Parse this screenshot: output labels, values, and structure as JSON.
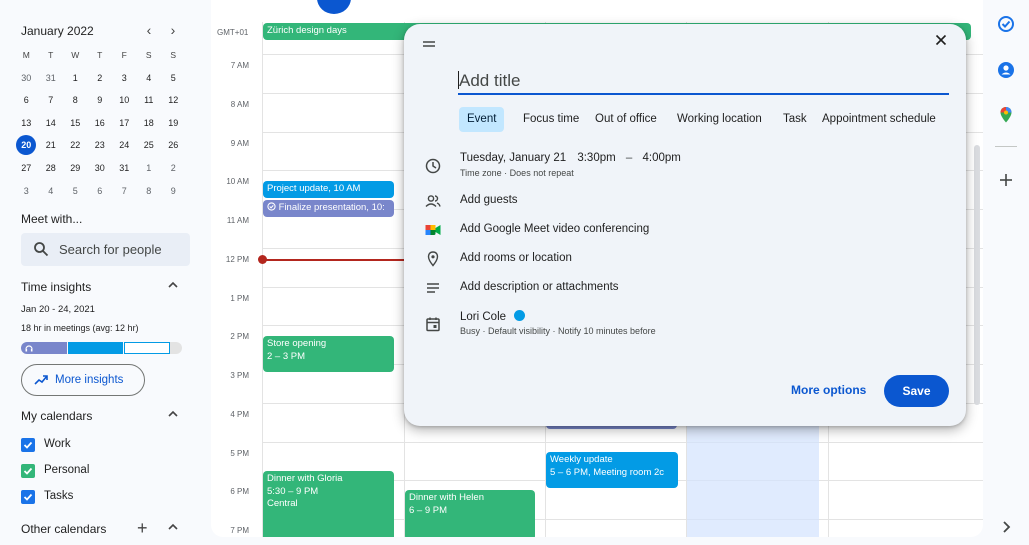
{
  "mini_calendar": {
    "month_label": "January 2022",
    "prev": "‹",
    "next": "›",
    "weekdays": [
      "M",
      "T",
      "W",
      "T",
      "F",
      "S",
      "S"
    ],
    "weeks": [
      [
        "30",
        "31",
        "1",
        "2",
        "3",
        "4",
        "5"
      ],
      [
        "6",
        "7",
        "8",
        "9",
        "10",
        "11",
        "12"
      ],
      [
        "13",
        "14",
        "15",
        "16",
        "17",
        "18",
        "19"
      ],
      [
        "20",
        "21",
        "22",
        "23",
        "24",
        "25",
        "26"
      ],
      [
        "27",
        "28",
        "29",
        "30",
        "31",
        "1",
        "2"
      ],
      [
        "3",
        "4",
        "5",
        "6",
        "7",
        "8",
        "9"
      ]
    ],
    "today": "20"
  },
  "meet_with": {
    "label": "Meet with...",
    "search_placeholder": "Search for people"
  },
  "time_insights": {
    "label": "Time insights",
    "date_range": "Jan 20 - 24, 2021",
    "hours": "18 hr in meetings (avg: 12 hr)",
    "more_button": "More insights"
  },
  "my_calendars": {
    "label": "My calendars",
    "items": [
      {
        "label": "Work",
        "color": "#1a73e8"
      },
      {
        "label": "Personal",
        "color": "#33b679"
      },
      {
        "label": "Tasks",
        "color": "#1a73e8"
      }
    ]
  },
  "other_calendars": {
    "label": "Other calendars",
    "add": "+"
  },
  "grid": {
    "timezone": "GMT+01",
    "hours": [
      "7 AM",
      "8 AM",
      "9 AM",
      "10 AM",
      "11 AM",
      "12 PM",
      "1 PM",
      "2 PM",
      "3 PM",
      "4 PM",
      "5 PM",
      "6 PM",
      "7 PM"
    ],
    "events": {
      "zurich": "Zürich design days",
      "project_update": "Project update, 10 AM",
      "finalize": "Finalize presentation, 10:",
      "store_title": "Store opening",
      "store_time": "2 – 3 PM",
      "weekly_title": "Weekly update",
      "weekly_time": "5 – 6 PM, Meeting room 2c",
      "gloria_title": "Dinner with Gloria",
      "gloria_time": "5:30 – 9 PM",
      "gloria_place": "Central",
      "helen_title": "Dinner with Helen",
      "helen_time": "6 – 9 PM"
    }
  },
  "dialog": {
    "title_placeholder": "Add title",
    "tabs": [
      "Event",
      "Focus time",
      "Out of office",
      "Working location",
      "Task",
      "Appointment schedule"
    ],
    "selected_tab": "Event",
    "datetime": "Tuesday, January 21",
    "start_time": "3:30pm",
    "dash": "–",
    "end_time": "4:00pm",
    "timezone_note": "Time zone · Does not repeat",
    "add_guests": "Add guests",
    "add_meet": "Add Google Meet video conferencing",
    "add_rooms": "Add rooms or location",
    "add_description": "Add description or attachments",
    "owner": "Lori Cole",
    "owner_color": "#039be5",
    "owner_sub": "Busy · Default visibility · Notify 10 minutes before",
    "more_options": "More options",
    "save": "Save"
  },
  "colors": {
    "accent": "#0b57d0",
    "event_green": "#33b679",
    "event_blue": "#039be5",
    "event_lavender": "#7986cb",
    "now_line": "#b3261e"
  }
}
